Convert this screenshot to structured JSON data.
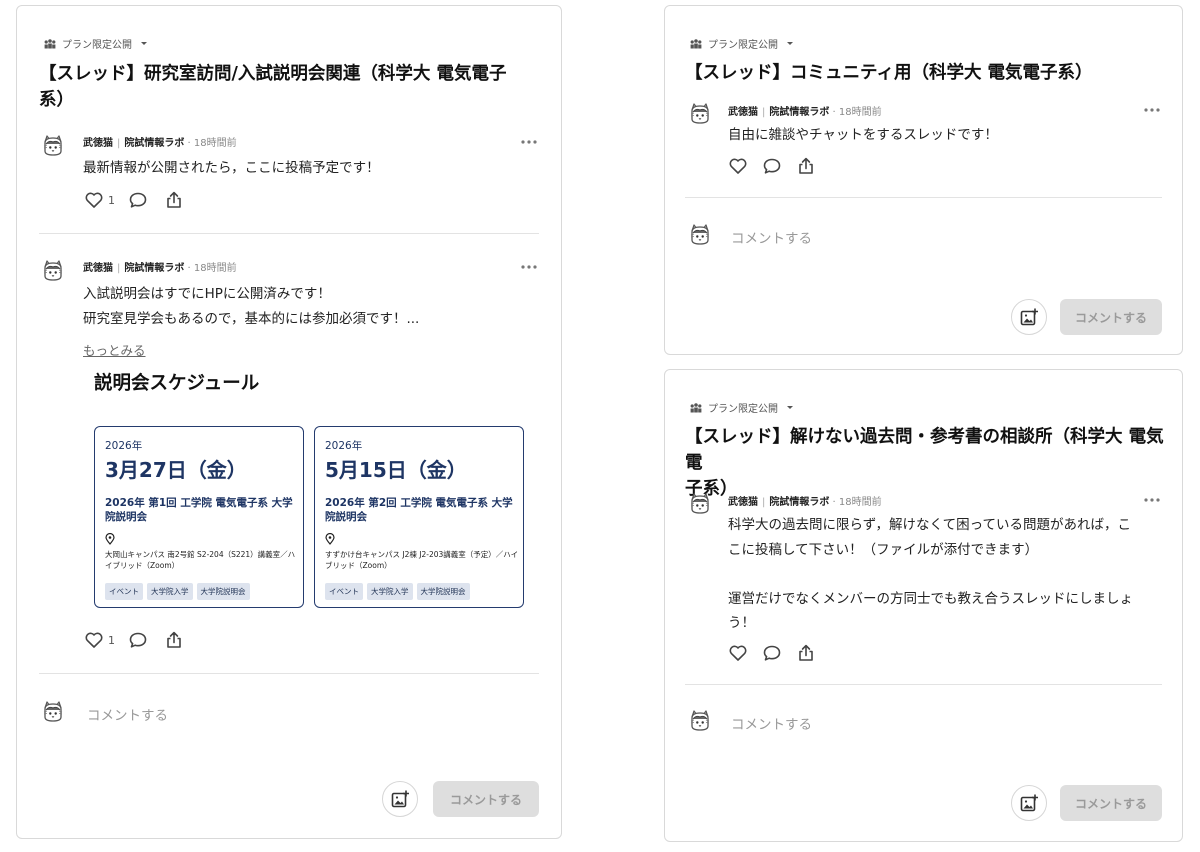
{
  "plan_label": "プラン限定公開",
  "author": "武徳猫",
  "org": "院試情報ラボ",
  "comment_placeholder": "コメントする",
  "comment_button": "コメントする",
  "thread1": {
    "title_line1": "【スレッド】研究室訪問/入試説明会関連（科学大 電気電子",
    "title_line2": "系）",
    "posts": [
      {
        "time": "18時間前",
        "lines": [
          "最新情報が公開されたら，ここに投稿予定です！"
        ],
        "likes": "1"
      },
      {
        "time": "18時間前",
        "lines": [
          "入試説明会はすでにHPに公開済みです！",
          "研究室見学会もあるので，基本的には参加必須です！..."
        ],
        "read_more": "もっとみる",
        "likes": "1"
      }
    ],
    "schedule": {
      "title": "説明会スケジュール",
      "events": [
        {
          "year": "2026年",
          "date": "3月27日（金）",
          "name": "2026年 第1回 工学院 電気電子系 大学院説明会",
          "location": "大岡山キャンパス 南2号館 S2-204（S221）講義室／ハイブリッド（Zoom）",
          "tags": [
            "イベント",
            "大学院入学",
            "大学院説明会"
          ]
        },
        {
          "year": "2026年",
          "date": "5月15日（金）",
          "name": "2026年 第2回 工学院 電気電子系 大学院説明会",
          "location": "すずかけ台キャンパス J2棟 J2-203講義室（予定）／ハイブリッド（Zoom）",
          "tags": [
            "イベント",
            "大学院入学",
            "大学院説明会"
          ]
        }
      ]
    }
  },
  "thread2": {
    "title": "【スレッド】コミュニティ用（科学大 電気電子系）",
    "post": {
      "time": "18時間前",
      "lines": [
        "自由に雑談やチャットをするスレッドです！"
      ]
    }
  },
  "thread3": {
    "title_line1": "【スレッド】解けない過去問・参考書の相談所（科学大 電気電",
    "title_line2": "子系）",
    "post": {
      "time": "18時間前",
      "lines": [
        "科学大の過去問に限らず，解けなくて困っている問題があれば，こ",
        "こに投稿して下さい！（ファイルが添付できます）",
        "",
        "運営だけでなくメンバーの方同士でも教え合うスレッドにしましょ",
        "う！"
      ]
    }
  }
}
